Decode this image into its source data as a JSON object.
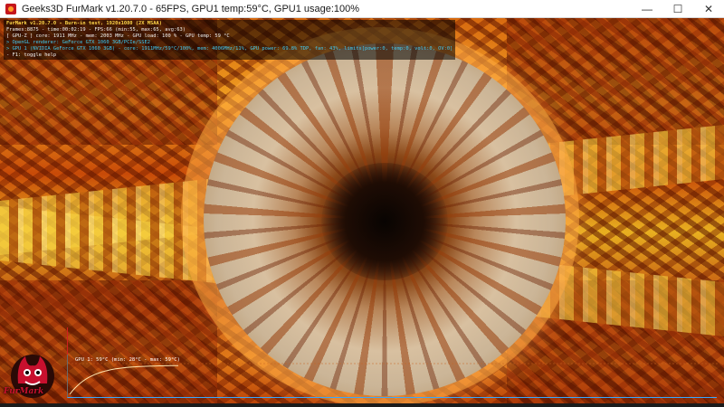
{
  "window": {
    "title": "Geeks3D FurMark v1.20.7.0 - 65FPS, GPU1 temp:59°C, GPU1 usage:100%",
    "minimize": "—",
    "maximize": "☐",
    "close": "✕"
  },
  "overlay": {
    "title": "FurMark v1.20.7.0 - Burn-in test, 1920x1080 (2X MSAA)",
    "frames": "Frames:8875 - time:00:02:19 - FPS:66 (min:55, max:65, avg:63)",
    "gpu2": "[ GPU-Z ] core: 1911 MHz - mem: 2003 MHz - GPU load: 100 % - GPU temp: 59 °C",
    "renderer": "> OpenGL renderer: GeForce GTX 1060 3GB/PCIe/SSE2",
    "gpu1": "> GPU 1 (NVIDIA GeForce GTX 1060 3GB) - core: 1911MHz/59°C/100%, mem: 4006MHz/11%, GPU power: 69.8% TDP, fan: 43%, limits[power:0, temp:0, volt:0, OV:0]",
    "help": "- F1: toggle help"
  },
  "graph": {
    "label": "GPU 1: 59°C (min: 28°C - max: 59°C)",
    "temperature_current": 59,
    "temperature_min": 28,
    "temperature_max": 59
  },
  "logo": {
    "text": "FurMark"
  },
  "colors": {
    "overlay_title": "#ffd84a",
    "overlay_cyan": "#41c8f0",
    "graph_line": "#39a7ff",
    "temp_curve": "#ffe6b0"
  }
}
